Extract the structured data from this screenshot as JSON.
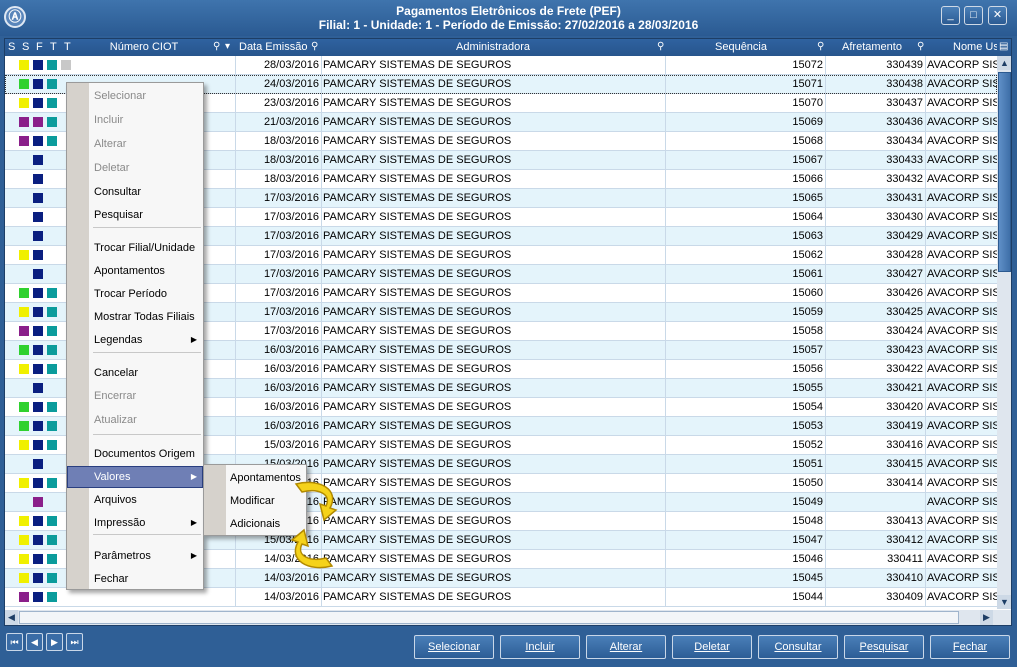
{
  "window": {
    "title_line1": "Pagamentos Eletrônicos de Frete (PEF)",
    "title_line2": "Filial: 1 - Unidade: 1 - Período de Emissão: 27/02/2016 a 28/03/2016",
    "minimize_icon": "minimize-icon",
    "maximize_icon": "maximize-icon",
    "close_icon": "close-icon"
  },
  "grid": {
    "columns": {
      "s1": "S",
      "s2": "S",
      "f": "F",
      "t1": "T",
      "t2": "T",
      "numero_ciot": "Número CIOT",
      "data_emissao": "Data Emissão",
      "administradora": "Administradora",
      "sequencia": "Sequência",
      "afretamento": "Afretamento",
      "nome_usuario": "Nome Us"
    },
    "rows": [
      {
        "data": "28/03/2016",
        "adm": "PAMCARY SISTEMAS DE SEGUROS",
        "seq": "15072",
        "afr": "330439",
        "nome": "AVACORP SIS",
        "c1": "#f0f000",
        "c2": "#0a1f80",
        "c3": "#0b9c9c",
        "c4": "#c8c8c8"
      },
      {
        "data": "24/03/2016",
        "adm": "PAMCARY SISTEMAS DE SEGUROS",
        "seq": "15071",
        "afr": "330438",
        "nome": "AVACORP SIS",
        "c1": "#2fd12f",
        "c2": "#0a1f80",
        "c3": "#0b9c9c",
        "c4": ""
      },
      {
        "data": "23/03/2016",
        "adm": "PAMCARY SISTEMAS DE SEGUROS",
        "seq": "15070",
        "afr": "330437",
        "nome": "AVACORP SIS",
        "c1": "#f0f000",
        "c2": "#0a1f80",
        "c3": "#0b9c9c",
        "c4": ""
      },
      {
        "data": "21/03/2016",
        "adm": "PAMCARY SISTEMAS DE SEGUROS",
        "seq": "15069",
        "afr": "330436",
        "nome": "AVACORP SIS",
        "c1": "#8a1f8a",
        "c2": "#8a1f8a",
        "c3": "#0b9c9c",
        "c4": ""
      },
      {
        "data": "18/03/2016",
        "adm": "PAMCARY SISTEMAS DE SEGUROS",
        "seq": "15068",
        "afr": "330434",
        "nome": "AVACORP SIS",
        "c1": "#8a1f8a",
        "c2": "#0a1f80",
        "c3": "#0b9c9c",
        "c4": ""
      },
      {
        "data": "18/03/2016",
        "adm": "PAMCARY SISTEMAS DE SEGUROS",
        "seq": "15067",
        "afr": "330433",
        "nome": "AVACORP SIS",
        "c1": "",
        "c2": "#0a1f80",
        "c3": "",
        "c4": ""
      },
      {
        "data": "18/03/2016",
        "adm": "PAMCARY SISTEMAS DE SEGUROS",
        "seq": "15066",
        "afr": "330432",
        "nome": "AVACORP SIS",
        "c1": "",
        "c2": "#0a1f80",
        "c3": "",
        "c4": ""
      },
      {
        "data": "17/03/2016",
        "adm": "PAMCARY SISTEMAS DE SEGUROS",
        "seq": "15065",
        "afr": "330431",
        "nome": "AVACORP SIS",
        "c1": "",
        "c2": "#0a1f80",
        "c3": "",
        "c4": ""
      },
      {
        "data": "17/03/2016",
        "adm": "PAMCARY SISTEMAS DE SEGUROS",
        "seq": "15064",
        "afr": "330430",
        "nome": "AVACORP SIS",
        "c1": "",
        "c2": "#0a1f80",
        "c3": "",
        "c4": ""
      },
      {
        "data": "17/03/2016",
        "adm": "PAMCARY SISTEMAS DE SEGUROS",
        "seq": "15063",
        "afr": "330429",
        "nome": "AVACORP SIS",
        "c1": "",
        "c2": "#0a1f80",
        "c3": "",
        "c4": ""
      },
      {
        "data": "17/03/2016",
        "adm": "PAMCARY SISTEMAS DE SEGUROS",
        "seq": "15062",
        "afr": "330428",
        "nome": "AVACORP SIS",
        "c1": "#f0f000",
        "c2": "#0a1f80",
        "c3": "",
        "c4": ""
      },
      {
        "data": "17/03/2016",
        "adm": "PAMCARY SISTEMAS DE SEGUROS",
        "seq": "15061",
        "afr": "330427",
        "nome": "AVACORP SIS",
        "c1": "",
        "c2": "#0a1f80",
        "c3": "",
        "c4": ""
      },
      {
        "data": "17/03/2016",
        "adm": "PAMCARY SISTEMAS DE SEGUROS",
        "seq": "15060",
        "afr": "330426",
        "nome": "AVACORP SIS",
        "c1": "#2fd12f",
        "c2": "#0a1f80",
        "c3": "#0b9c9c",
        "c4": ""
      },
      {
        "data": "17/03/2016",
        "adm": "PAMCARY SISTEMAS DE SEGUROS",
        "seq": "15059",
        "afr": "330425",
        "nome": "AVACORP SIS",
        "c1": "#f0f000",
        "c2": "#0a1f80",
        "c3": "#0b9c9c",
        "c4": ""
      },
      {
        "data": "17/03/2016",
        "adm": "PAMCARY SISTEMAS DE SEGUROS",
        "seq": "15058",
        "afr": "330424",
        "nome": "AVACORP SIS",
        "c1": "#8a1f8a",
        "c2": "#0a1f80",
        "c3": "#0b9c9c",
        "c4": ""
      },
      {
        "data": "16/03/2016",
        "adm": "PAMCARY SISTEMAS DE SEGUROS",
        "seq": "15057",
        "afr": "330423",
        "nome": "AVACORP SIS",
        "c1": "#2fd12f",
        "c2": "#0a1f80",
        "c3": "#0b9c9c",
        "c4": ""
      },
      {
        "data": "16/03/2016",
        "adm": "PAMCARY SISTEMAS DE SEGUROS",
        "seq": "15056",
        "afr": "330422",
        "nome": "AVACORP SIS",
        "c1": "#f0f000",
        "c2": "#0a1f80",
        "c3": "#0b9c9c",
        "c4": ""
      },
      {
        "data": "16/03/2016",
        "adm": "PAMCARY SISTEMAS DE SEGUROS",
        "seq": "15055",
        "afr": "330421",
        "nome": "AVACORP SIS",
        "c1": "",
        "c2": "#0a1f80",
        "c3": "",
        "c4": ""
      },
      {
        "data": "16/03/2016",
        "adm": "PAMCARY SISTEMAS DE SEGUROS",
        "seq": "15054",
        "afr": "330420",
        "nome": "AVACORP SIS",
        "c1": "#2fd12f",
        "c2": "#0a1f80",
        "c3": "#0b9c9c",
        "c4": ""
      },
      {
        "data": "16/03/2016",
        "adm": "PAMCARY SISTEMAS DE SEGUROS",
        "seq": "15053",
        "afr": "330419",
        "nome": "AVACORP SIS",
        "c1": "#2fd12f",
        "c2": "#0a1f80",
        "c3": "#0b9c9c",
        "c4": ""
      },
      {
        "data": "15/03/2016",
        "adm": "PAMCARY SISTEMAS DE SEGUROS",
        "seq": "15052",
        "afr": "330416",
        "nome": "AVACORP SIS",
        "c1": "#f0f000",
        "c2": "#0a1f80",
        "c3": "#0b9c9c",
        "c4": ""
      },
      {
        "data": "15/03/2016",
        "adm": "PAMCARY SISTEMAS DE SEGUROS",
        "seq": "15051",
        "afr": "330415",
        "nome": "AVACORP SIS",
        "c1": "",
        "c2": "#0a1f80",
        "c3": "",
        "c4": ""
      },
      {
        "data": "15/03/2016",
        "adm": "PAMCARY SISTEMAS DE SEGUROS",
        "seq": "15050",
        "afr": "330414",
        "nome": "AVACORP SIS",
        "c1": "#f0f000",
        "c2": "#0a1f80",
        "c3": "#0b9c9c",
        "c4": ""
      },
      {
        "data": "15/03/2016",
        "adm": "PAMCARY SISTEMAS DE SEGUROS",
        "seq": "15049",
        "afr": "",
        "nome": "AVACORP SIS",
        "c1": "",
        "c2": "#8a1f8a",
        "c3": "",
        "c4": ""
      },
      {
        "data": "15/03/2016",
        "adm": "PAMCARY SISTEMAS DE SEGUROS",
        "seq": "15048",
        "afr": "330413",
        "nome": "AVACORP SIS",
        "c1": "#f0f000",
        "c2": "#0a1f80",
        "c3": "#0b9c9c",
        "c4": ""
      },
      {
        "data": "15/03/2016",
        "adm": "PAMCARY SISTEMAS DE SEGUROS",
        "seq": "15047",
        "afr": "330412",
        "nome": "AVACORP SIS",
        "c1": "#f0f000",
        "c2": "#0a1f80",
        "c3": "#0b9c9c",
        "c4": ""
      },
      {
        "data": "14/03/2016",
        "adm": "PAMCARY SISTEMAS DE SEGUROS",
        "seq": "15046",
        "afr": "330411",
        "nome": "AVACORP SIS",
        "c1": "#f0f000",
        "c2": "#0a1f80",
        "c3": "#0b9c9c",
        "c4": ""
      },
      {
        "data": "14/03/2016",
        "adm": "PAMCARY SISTEMAS DE SEGUROS",
        "seq": "15045",
        "afr": "330410",
        "nome": "AVACORP SIS",
        "c1": "#f0f000",
        "c2": "#0a1f80",
        "c3": "#0b9c9c",
        "c4": ""
      },
      {
        "data": "14/03/2016",
        "adm": "PAMCARY SISTEMAS DE SEGUROS",
        "seq": "15044",
        "afr": "330409",
        "nome": "AVACORP SIS",
        "c1": "#8a1f8a",
        "c2": "#0a1f80",
        "c3": "#0b9c9c",
        "c4": ""
      }
    ]
  },
  "context_menu": {
    "items": [
      {
        "label": "Selecionar",
        "disabled": true
      },
      {
        "label": "Incluir",
        "disabled": true
      },
      {
        "label": "Alterar",
        "disabled": true
      },
      {
        "label": "Deletar",
        "disabled": true
      },
      {
        "label": "Consultar",
        "disabled": false
      },
      {
        "label": "Pesquisar",
        "disabled": false
      },
      {
        "label": "Trocar Filial/Unidade",
        "disabled": false
      },
      {
        "label": "Apontamentos",
        "disabled": false
      },
      {
        "label": "Trocar Período",
        "disabled": false
      },
      {
        "label": "Mostrar Todas Filiais",
        "disabled": false
      },
      {
        "label": "Legendas",
        "disabled": false
      },
      {
        "label": "Cancelar",
        "disabled": false
      },
      {
        "label": "Encerrar",
        "disabled": true
      },
      {
        "label": "Atualizar",
        "disabled": true
      },
      {
        "label": "Documentos Origem",
        "disabled": false
      },
      {
        "label": "Valores",
        "disabled": false
      },
      {
        "label": "Arquivos",
        "disabled": false
      },
      {
        "label": "Impressão",
        "disabled": false
      },
      {
        "label": "Parâmetros",
        "disabled": false
      },
      {
        "label": "Fechar",
        "disabled": false
      }
    ],
    "highlighted": "Valores"
  },
  "submenu": {
    "items": [
      "Apontamentos",
      "Modificar",
      "Adicionais"
    ]
  },
  "bottom_buttons": [
    "Selecionar",
    "Incluir",
    "Alterar",
    "Deletar",
    "Consultar",
    "Pesquisar",
    "Fechar"
  ],
  "nav_icons": [
    "first-record-icon",
    "prev-record-icon",
    "next-record-icon",
    "last-record-icon"
  ],
  "colors": {
    "header_bg": "#2f62a0",
    "row_alt": "#e4f4fb",
    "menu_highlight": "#6f7fb5",
    "status_yellow": "#f0f000",
    "status_green": "#2fd12f",
    "status_navy": "#0a1f80",
    "status_teal": "#0b9c9c",
    "status_purple": "#8a1f8a"
  }
}
